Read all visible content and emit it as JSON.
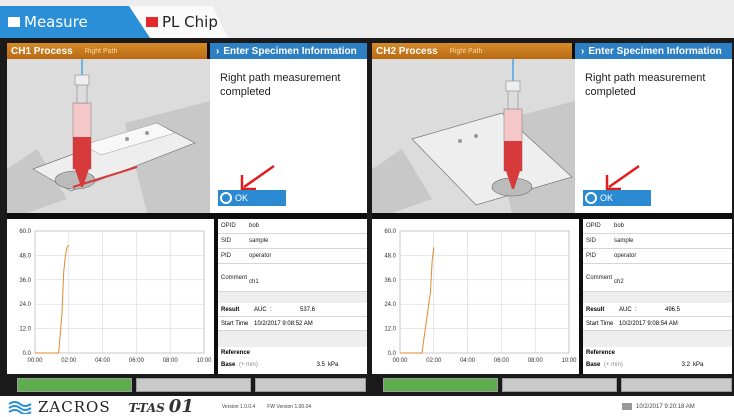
{
  "tabs": [
    {
      "label": "Measure",
      "active": true
    },
    {
      "label": "PL Chip",
      "active": false
    }
  ],
  "channels": [
    {
      "process_title": "CH1 Process",
      "process_sub": "Right Path",
      "spec_title": "Enter Specimen Information",
      "message": "Right path measurement completed",
      "ok_label": "OK",
      "info": {
        "opid_label": "OPID",
        "opid": "bob",
        "sid_label": "SID",
        "sid": "sample",
        "pid_label": "PID",
        "pid": "operator",
        "comment_label": "Comment",
        "comment": "ch1",
        "result_label": "Result",
        "auc_label": "AUC",
        "auc_sep": ":",
        "auc_value": "537.6",
        "start_label": "Start Time",
        "start_time": "10/2/2017 9:08:52 AM",
        "reference_label": "Reference",
        "base_label": "Base",
        "base_unit_hint": "(+ min)",
        "base_value": "3.5",
        "base_unit": "kPa"
      },
      "chart_data": {
        "type": "line",
        "x_ticks": [
          "00:00",
          "02:00",
          "04:00",
          "06:00",
          "08:00",
          "10:00"
        ],
        "y_ticks": [
          "60.0",
          "48.0",
          "36.0",
          "24.0",
          "12.0",
          "0.0"
        ],
        "ylim": [
          0,
          60
        ],
        "xlim": [
          0,
          10
        ],
        "series": [
          {
            "x": [
              0,
              1.4,
              1.6,
              1.7,
              1.8,
              1.9,
              2.0
            ],
            "y": [
              0,
              0,
              20,
              40,
              48,
              52,
              53
            ],
            "color": "#e48a2a"
          }
        ]
      }
    },
    {
      "process_title": "CH2 Process",
      "process_sub": "Right Path",
      "spec_title": "Enter Specimen Information",
      "message": "Right path measurement completed",
      "ok_label": "OK",
      "info": {
        "opid_label": "OPID",
        "opid": "bob",
        "sid_label": "SID",
        "sid": "sample",
        "pid_label": "PID",
        "pid": "operator",
        "comment_label": "Comment",
        "comment": "ch2",
        "result_label": "Result",
        "auc_label": "AUC",
        "auc_sep": ":",
        "auc_value": "496.5",
        "start_label": "Start Time",
        "start_time": "10/2/2017 9:08:54 AM",
        "reference_label": "Reference",
        "base_label": "Base",
        "base_unit_hint": "(+ min)",
        "base_value": "3.2",
        "base_unit": "kPa"
      },
      "chart_data": {
        "type": "line",
        "x_ticks": [
          "00:00",
          "02:00",
          "04:00",
          "06:00",
          "08:00",
          "10:00"
        ],
        "y_ticks": [
          "60.0",
          "48.0",
          "36.0",
          "24.0",
          "12.0",
          "0.0"
        ],
        "ylim": [
          0,
          60
        ],
        "xlim": [
          0,
          10
        ],
        "series": [
          {
            "x": [
              0,
              1.3,
              1.5,
              1.7,
              1.8,
              1.9,
              2.0
            ],
            "y": [
              0,
              0,
              12,
              24,
              30,
              45,
              52
            ],
            "color": "#e48a2a"
          }
        ]
      }
    }
  ],
  "footer": {
    "brand": "ZACROS",
    "product": "T-TAS",
    "product_num": "01",
    "version": "Version 1.0.0.4",
    "fw_version": "FW Version 1.00.04",
    "datetime": "10/2/2017 9:20:18 AM"
  },
  "colors": {
    "accent": "#2a8fd6",
    "process_header": "#c97a1e",
    "series": "#e48a2a",
    "green_button": "#5dad4e"
  }
}
